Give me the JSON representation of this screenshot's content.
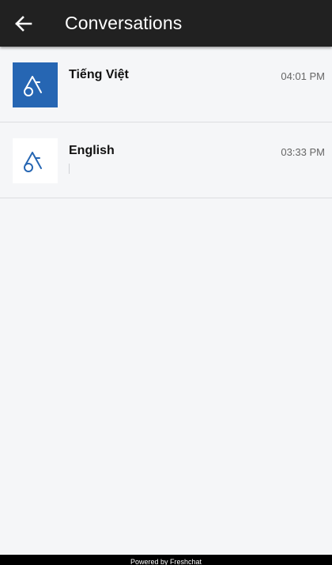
{
  "header": {
    "back_icon": "arrow-left-icon",
    "title": "Conversations"
  },
  "conversations": [
    {
      "title": "Tiếng Việt",
      "time": "04:01 PM",
      "avatar_icon": "brand-logo-icon",
      "avatar_bg": "#2666b3",
      "avatar_fg": "#ffffff"
    },
    {
      "title": "English",
      "time": "03:33 PM",
      "avatar_icon": "brand-logo-icon",
      "avatar_bg": "#ffffff",
      "avatar_fg": "#2666b3"
    }
  ],
  "footer": {
    "text": "Powered by Freshchat"
  },
  "colors": {
    "appbar": "#212121",
    "background": "#f5f6f8",
    "accent": "#2666b3"
  }
}
